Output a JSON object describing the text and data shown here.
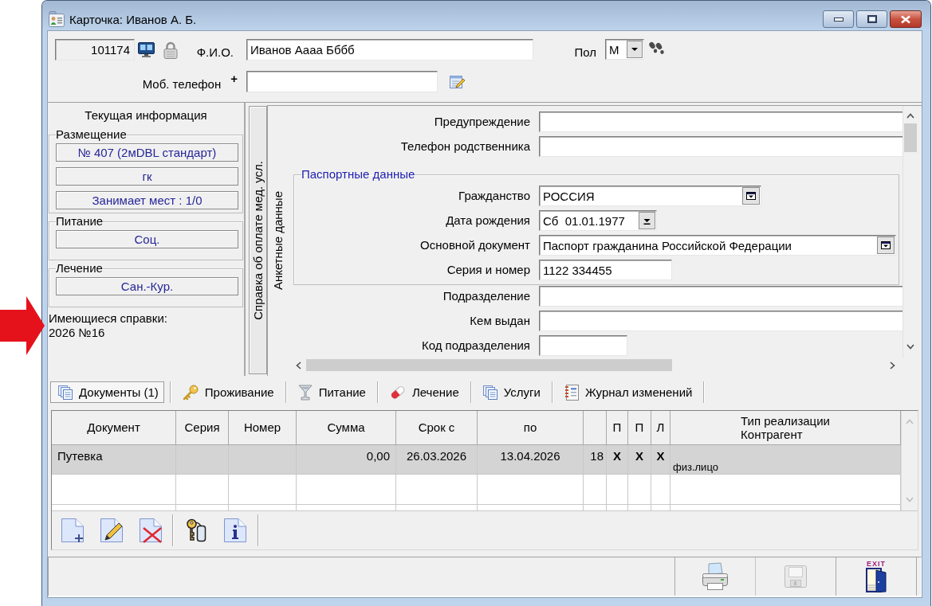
{
  "window": {
    "title": "Карточка: Иванов А. Б."
  },
  "header": {
    "record_number": "101174",
    "full_name_label": "Ф.И.О.",
    "full_name": "Иванов Аааа Бббб",
    "sex_label": "Пол",
    "sex": "М",
    "mobile_label": "Моб. телефон",
    "mobile_prefix": "+"
  },
  "current_info": {
    "title": "Текущая информация",
    "groups": [
      {
        "legend": "Размещение",
        "values": [
          "№ 407 (2мDBL стандарт)",
          "гк",
          "Занимает мест : 1/0"
        ]
      },
      {
        "legend": "Питание",
        "values": [
          "Соц."
        ]
      },
      {
        "legend": "Лечение",
        "values": [
          "Сан.-Кур."
        ]
      }
    ],
    "certificates_label": "Имеющиеся справки:",
    "certificates": [
      "2026 №16"
    ]
  },
  "side_tabs": [
    {
      "label": "Справка об оплате мед. усл.",
      "selected": false
    },
    {
      "label": "Анкетные данные",
      "selected": true
    }
  ],
  "form": {
    "fields_top": [
      {
        "label": "Предупреждение",
        "kind": "text"
      },
      {
        "label": "Телефон родственника",
        "kind": "text"
      }
    ],
    "passport": {
      "legend": "Паспортные данные",
      "fields": [
        {
          "label": "Гражданство",
          "kind": "lookup",
          "value": "РОССИЯ"
        },
        {
          "label": "Дата рождения",
          "kind": "date",
          "value": "Сб  01.01.1977"
        },
        {
          "label": "Основной документ",
          "kind": "lookup",
          "value": "Паспорт гражданина Российской Федерации"
        },
        {
          "label": "Серия и номер",
          "kind": "text",
          "value": "1122 334455"
        }
      ]
    },
    "fields_bottom": [
      {
        "label": "Подразделение",
        "kind": "text"
      },
      {
        "label": "Кем выдан",
        "kind": "text"
      },
      {
        "label": "Код подразделения",
        "kind": "text"
      }
    ]
  },
  "bottom_tabs": [
    {
      "label": "Документы (1)",
      "selected": true
    },
    {
      "label": "Проживание",
      "selected": false
    },
    {
      "label": "Питание",
      "selected": false
    },
    {
      "label": "Лечение",
      "selected": false
    },
    {
      "label": "Услуги",
      "selected": false
    },
    {
      "label": "Журнал изменений",
      "selected": false
    }
  ],
  "documents_table": {
    "columns": {
      "document": "Документ",
      "series": "Серия",
      "number": "Номер",
      "sum": "Сумма",
      "date_from": "Срок с",
      "date_to": "по",
      "column_8": "П",
      "column_9": "П",
      "column_10": "Л",
      "realization_type": "Тип реализации",
      "counterparty": "Контрагент"
    },
    "rows": [
      {
        "selected": true,
        "document": "Путевка",
        "sum": "0,00",
        "date_from": "26.03.2026",
        "date_to": "13.04.2026",
        "column_7": "18",
        "column_8": "X",
        "column_9": "X",
        "column_10": "X",
        "counterparty": "физ.лицо"
      }
    ]
  },
  "footer": {
    "buttons": [
      {
        "disabled": false
      },
      {
        "disabled": true
      },
      {
        "label": "EXIT",
        "disabled": false
      }
    ]
  }
}
